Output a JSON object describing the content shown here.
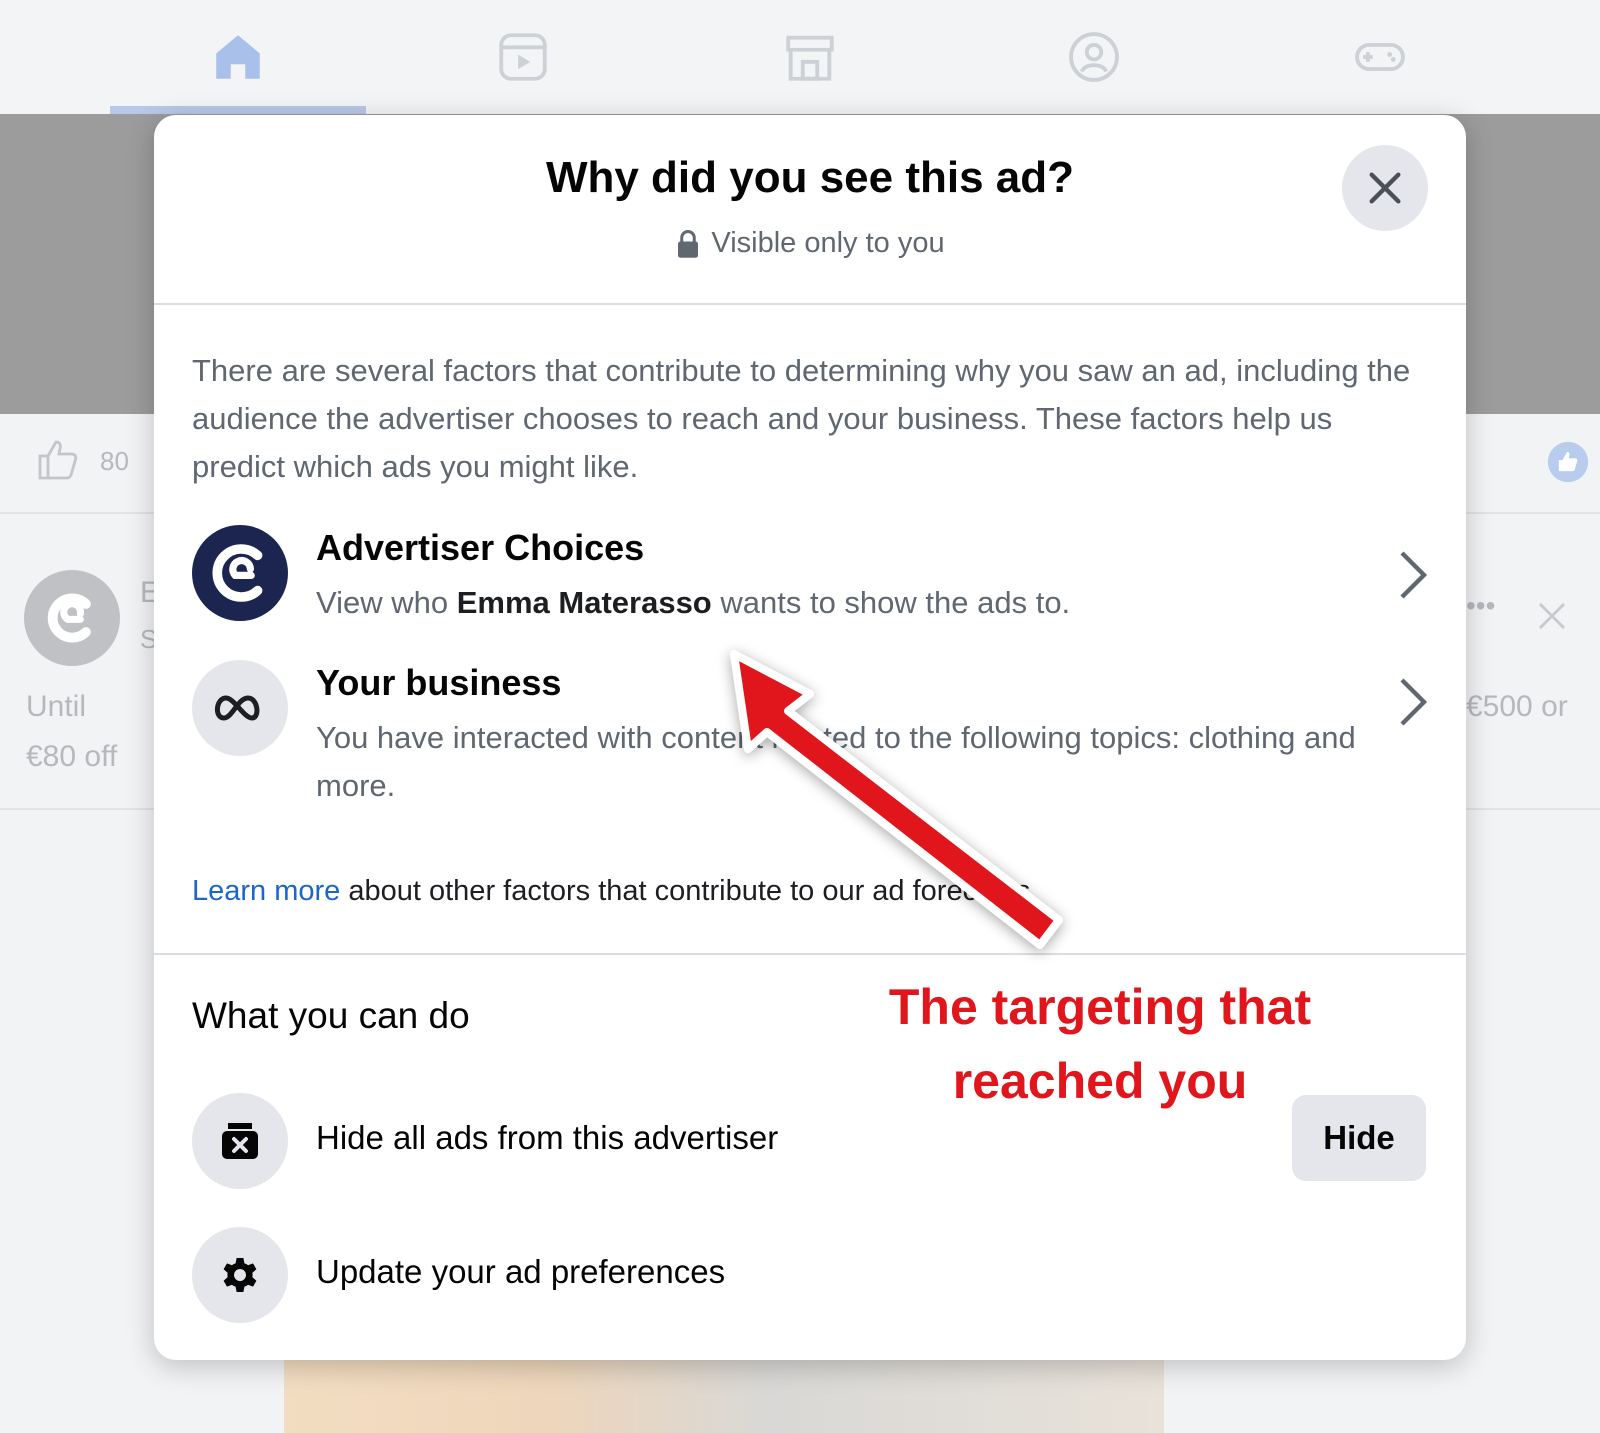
{
  "background": {
    "nav_tabs": [
      {
        "icon": "home-icon"
      },
      {
        "icon": "video-icon"
      },
      {
        "icon": "marketplace-icon"
      },
      {
        "icon": "groups-icon"
      },
      {
        "icon": "gaming-icon"
      }
    ],
    "likes_count": "80",
    "post_snippet_line1": "Until",
    "post_snippet_line2": "€80 off",
    "post_snippet_right": "€500 or"
  },
  "modal": {
    "title": "Why did you see this ad?",
    "subtitle": "Visible only to you",
    "intro": "There are several factors that contribute to determining why you saw an ad, including the audience the advertiser chooses to reach and your business. These factors help us predict which ads you might like.",
    "reasons": [
      {
        "title": "Advertiser Choices",
        "desc_prefix": "View who ",
        "desc_bold": "Emma Materasso",
        "desc_suffix": " wants to show the ads to."
      },
      {
        "title": "Your business",
        "desc": "You have interacted with content related to the following topics: clothing and more."
      }
    ],
    "learn_more_link": "Learn more",
    "learn_more_text": " about other factors that contribute to our ad forecasts.",
    "section_title": "What you can do",
    "actions": [
      {
        "label": "Hide all ads from this advertiser",
        "button": "Hide",
        "icon": "hide-ad-icon"
      },
      {
        "label": "Update your ad preferences",
        "icon": "gear-icon"
      }
    ]
  },
  "annotation": {
    "line1": "The targeting that",
    "line2": "reached you",
    "color": "#e0161c"
  }
}
